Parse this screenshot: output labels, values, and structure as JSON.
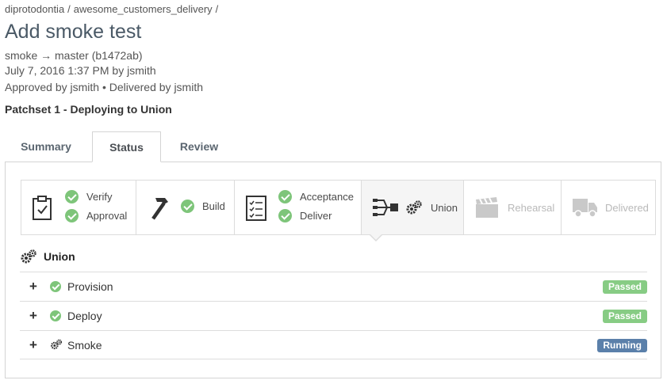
{
  "breadcrumb": {
    "org": "diprotodontia",
    "project": "awesome_customers_delivery",
    "separator": "/"
  },
  "change": {
    "title": "Add smoke test",
    "branches": "smoke → master (b1472ab)",
    "date_line": "July 7, 2016 1:37 PM by jsmith",
    "approval_line": "Approved by jsmith • Delivered by jsmith",
    "patchset": "Patchset 1 - Deploying to Union"
  },
  "tabs": [
    {
      "label": "Summary",
      "active": false
    },
    {
      "label": "Status",
      "active": true
    },
    {
      "label": "Review",
      "active": false
    }
  ],
  "pipeline": {
    "verify": {
      "icon": "clipboard-check-icon",
      "items": [
        "Verify",
        "Approval"
      ]
    },
    "build": {
      "icon": "hammer-icon",
      "items": [
        "Build"
      ]
    },
    "acceptance": {
      "icon": "checklist-icon",
      "items": [
        "Acceptance",
        "Deliver"
      ]
    },
    "union": {
      "icon": "fan-in-icon",
      "label": "Union",
      "status_icon": "gears-icon"
    },
    "rehearsal": {
      "icon": "clapperboard-icon",
      "label": "Rehearsal"
    },
    "delivered": {
      "icon": "truck-icon",
      "label": "Delivered"
    }
  },
  "stage_detail": {
    "title": "Union",
    "jobs": [
      {
        "name": "Provision",
        "status": "Passed",
        "state": "passed"
      },
      {
        "name": "Deploy",
        "status": "Passed",
        "state": "passed"
      },
      {
        "name": "Smoke",
        "status": "Running",
        "state": "running"
      }
    ]
  },
  "colors": {
    "passed": "#87cc84",
    "running": "#5b80aa",
    "check": "#7ec57a",
    "title": "#4a5966"
  }
}
